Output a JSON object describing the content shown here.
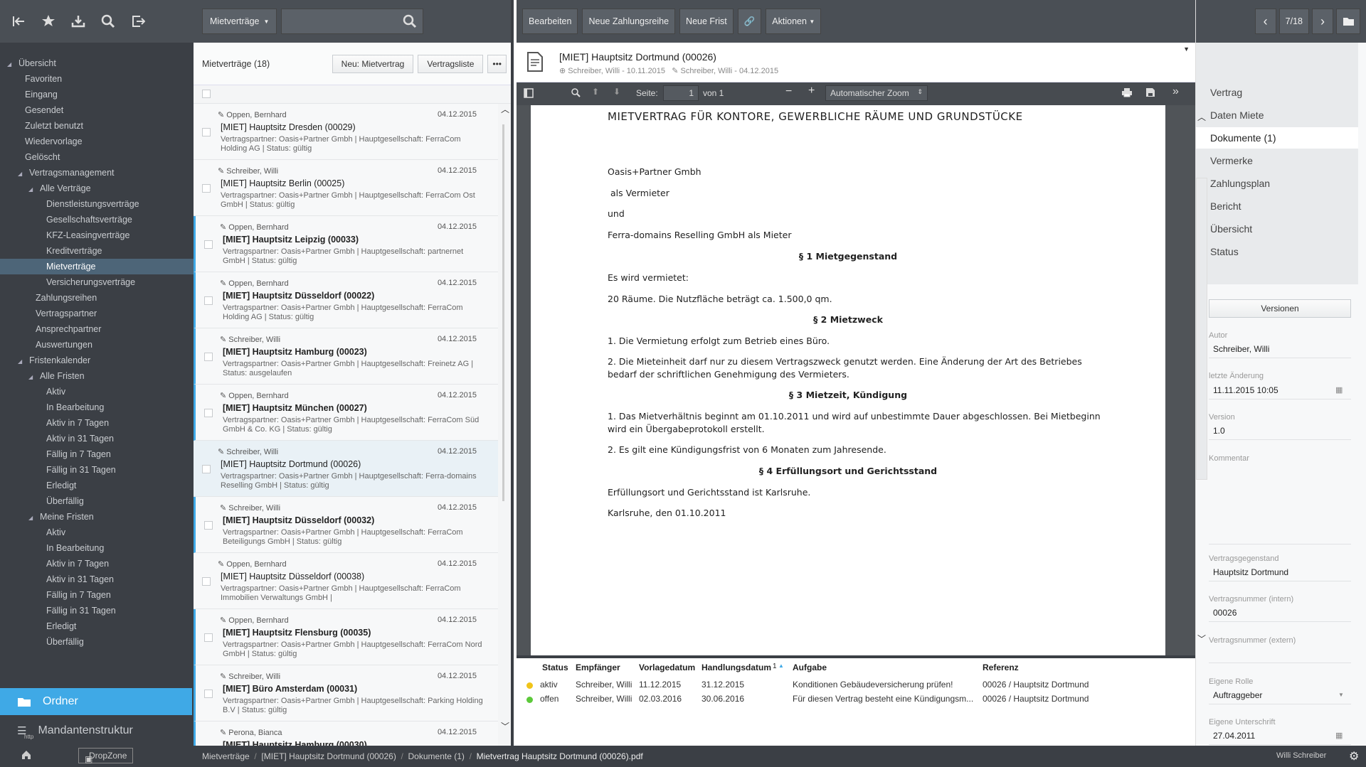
{
  "nav": {
    "tree": [
      {
        "label": "Übersicht",
        "level": 0,
        "expanded": true
      },
      {
        "label": "Favoriten",
        "level": 1
      },
      {
        "label": "Eingang",
        "level": 1
      },
      {
        "label": "Gesendet",
        "level": 1
      },
      {
        "label": "Zuletzt benutzt",
        "level": 1
      },
      {
        "label": "Wiedervorlage",
        "level": 1
      },
      {
        "label": "Gelöscht",
        "level": 1
      },
      {
        "label": "Vertragsmanagement",
        "level": 1,
        "expanded": true
      },
      {
        "label": "Alle Verträge",
        "level": 2,
        "expanded": true
      },
      {
        "label": "Dienstleistungsverträge",
        "level": 3
      },
      {
        "label": "Gesellschaftsverträge",
        "level": 3
      },
      {
        "label": "KFZ-Leasingverträge",
        "level": 3
      },
      {
        "label": "Kreditverträge",
        "level": 3
      },
      {
        "label": "Mietverträge",
        "level": 3,
        "active": true
      },
      {
        "label": "Versicherungsverträge",
        "level": 3
      },
      {
        "label": "Zahlungsreihen",
        "level": 2
      },
      {
        "label": "Vertragspartner",
        "level": 2
      },
      {
        "label": "Ansprechpartner",
        "level": 2
      },
      {
        "label": "Auswertungen",
        "level": 2
      },
      {
        "label": "Fristenkalender",
        "level": 1,
        "expanded": true
      },
      {
        "label": "Alle Fristen",
        "level": 2,
        "expanded": true
      },
      {
        "label": "Aktiv",
        "level": 3
      },
      {
        "label": "In Bearbeitung",
        "level": 3
      },
      {
        "label": "Aktiv in 7 Tagen",
        "level": 3
      },
      {
        "label": "Aktiv in 31 Tagen",
        "level": 3
      },
      {
        "label": "Fällig in 7 Tagen",
        "level": 3
      },
      {
        "label": "Fällig in 31 Tagen",
        "level": 3
      },
      {
        "label": "Erledigt",
        "level": 3
      },
      {
        "label": "Überfällig",
        "level": 3
      },
      {
        "label": "Meine Fristen",
        "level": 2,
        "expanded": true
      },
      {
        "label": "Aktiv",
        "level": 3
      },
      {
        "label": "In Bearbeitung",
        "level": 3
      },
      {
        "label": "Aktiv in 7 Tagen",
        "level": 3
      },
      {
        "label": "Aktiv in 31 Tagen",
        "level": 3
      },
      {
        "label": "Fällig in 7 Tagen",
        "level": 3
      },
      {
        "label": "Fällig in 31 Tagen",
        "level": 3
      },
      {
        "label": "Erledigt",
        "level": 3
      },
      {
        "label": "Überfällig",
        "level": 3
      }
    ],
    "ordner_label": "Ordner",
    "mandant_label": "Mandantenstruktur",
    "http_label": "http"
  },
  "list": {
    "dropdown_label": "Mietverträge",
    "search_placeholder": "",
    "title": "Mietverträge (18)",
    "new_button": "Neu: Mietvertrag",
    "list_button": "Vertragsliste",
    "more_button": "•••",
    "rows": [
      {
        "author": "Oppen, Bernhard",
        "date": "04.12.2015",
        "title": "[MIET] Hauptsitz Dresden (00029)",
        "sub": "Vertragspartner: Oasis+Partner Gmbh  |  Hauptgesellschaft: FerraCom Holding AG  |  Status: gültig",
        "bold": false,
        "hl": false,
        "sel": false
      },
      {
        "author": "Schreiber, Willi",
        "date": "04.12.2015",
        "title": "[MIET] Hauptsitz Berlin (00025)",
        "sub": "Vertragspartner: Oasis+Partner Gmbh  |  Hauptgesellschaft: FerraCom Ost GmbH  |  Status: gültig",
        "bold": false,
        "hl": false,
        "sel": false
      },
      {
        "author": "Oppen, Bernhard",
        "date": "04.12.2015",
        "title": "[MIET] Hauptsitz Leipzig (00033)",
        "sub": "Vertragspartner: Oasis+Partner Gmbh  |  Hauptgesellschaft: partnernet GmbH  |  Status: gültig",
        "bold": true,
        "hl": true,
        "sel": false
      },
      {
        "author": "Oppen, Bernhard",
        "date": "04.12.2015",
        "title": "[MIET] Hauptsitz Düsseldorf (00022)",
        "sub": "Vertragspartner: Oasis+Partner Gmbh  |  Hauptgesellschaft: FerraCom Holding AG  |  Status: gültig",
        "bold": true,
        "hl": true,
        "sel": false
      },
      {
        "author": "Schreiber, Willi",
        "date": "04.12.2015",
        "title": "[MIET] Hauptsitz Hamburg (00023)",
        "sub": "Vertragspartner: Oasis+Partner Gmbh  |  Hauptgesellschaft: Freinetz AG  |  Status: ausgelaufen",
        "bold": true,
        "hl": true,
        "sel": false
      },
      {
        "author": "Oppen, Bernhard",
        "date": "04.12.2015",
        "title": "[MIET] Hauptsitz München (00027)",
        "sub": "Vertragspartner: Oasis+Partner Gmbh  |  Hauptgesellschaft: FerraCom Süd GmbH & Co. KG  |  Status: gültig",
        "bold": true,
        "hl": true,
        "sel": false
      },
      {
        "author": "Schreiber, Willi",
        "date": "04.12.2015",
        "title": "[MIET] Hauptsitz Dortmund (00026)",
        "sub": "Vertragspartner: Oasis+Partner Gmbh  |  Hauptgesellschaft: Ferra-domains Reselling GmbH  |  Status: gültig",
        "bold": false,
        "hl": false,
        "sel": true
      },
      {
        "author": "Schreiber, Willi",
        "date": "04.12.2015",
        "title": "[MIET] Hauptsitz Düsseldorf (00032)",
        "sub": "Vertragspartner: Oasis+Partner Gmbh  |  Hauptgesellschaft: FerraCom Beteiligungs GmbH  |  Status: gültig",
        "bold": true,
        "hl": true,
        "sel": false
      },
      {
        "author": "Oppen, Bernhard",
        "date": "04.12.2015",
        "title": "[MIET] Hauptsitz Düsseldorf (00038)",
        "sub": "Vertragspartner: Oasis+Partner Gmbh  |  Hauptgesellschaft: FerraCom Immobilien Verwaltungs GmbH  |",
        "bold": false,
        "hl": false,
        "sel": false
      },
      {
        "author": "Oppen, Bernhard",
        "date": "04.12.2015",
        "title": "[MIET] Hauptsitz Flensburg (00035)",
        "sub": "Vertragspartner: Oasis+Partner Gmbh  |  Hauptgesellschaft: FerraCom Nord GmbH  |  Status: gültig",
        "bold": true,
        "hl": true,
        "sel": false
      },
      {
        "author": "Schreiber, Willi",
        "date": "04.12.2015",
        "title": "[MIET] Büro Amsterdam (00031)",
        "sub": "Vertragspartner: Oasis+Partner Gmbh  |  Hauptgesellschaft: Parking Holding B.V  |  Status: gültig",
        "bold": true,
        "hl": true,
        "sel": false
      },
      {
        "author": "Perona, Bianca",
        "date": "04.12.2015",
        "title": "[MIET] Hauptsitz Hamburg (00030)",
        "sub": "",
        "bold": true,
        "hl": true,
        "sel": false
      }
    ]
  },
  "doc": {
    "toolbar": [
      "Bearbeiten",
      "Neue Zahlungsreihe",
      "Neue Frist"
    ],
    "actions_label": "Aktionen",
    "title": "[MIET] Hauptsitz Dortmund (00026)",
    "meta1": "Schreiber, Willi - 10.11.2015",
    "meta2": "Schreiber, Willi - 04.12.2015",
    "pdf": {
      "page_label": "Seite:",
      "page_value": "1",
      "page_of": "von 1",
      "zoom": "Automatischer Zoom"
    },
    "page_lines": {
      "heading": "MIETVERTRAG FÜR KONTORE, GEWERBLICHE RÄUME UND GRUNDSTÜCKE",
      "l1": "Oasis+Partner Gmbh",
      "l2": "als Vermieter",
      "l3": "und",
      "l4": "Ferra-domains Reselling GmbH als Mieter",
      "s1": "§ 1 Mietgegenstand",
      "l5": "Es wird vermietet:",
      "l6": "20 Räume. Die Nutzfläche beträgt ca. 1.500,0 qm.",
      "s2": "§ 2 Mietzweck",
      "l7": "1. Die Vermietung erfolgt zum Betrieb eines Büro.",
      "l8": "2. Die Mieteinheit darf nur zu diesem Vertragszweck genutzt werden. Eine Änderung der Art des Betriebes",
      "l9": "bedarf der schriftlichen Genehmigung des Vermieters.",
      "s3": "§ 3 Mietzeit, Kündigung",
      "l10": "1. Das Mietverhältnis beginnt am 01.10.2011 und wird auf unbestimmte Dauer abgeschlossen. Bei Mietbeginn",
      "l11": "wird ein Übergabeprotokoll erstellt.",
      "l12": "2. Es gilt eine Kündigungsfrist von 6 Monaten zum Jahresende.",
      "s4": "§ 4 Erfüllungsort und Gerichtsstand",
      "l13": "Erfüllungsort und Gerichtsstand ist Karlsruhe.",
      "l14": "Karlsruhe, den 01.10.2011"
    },
    "tasks": {
      "headers": {
        "status": "Status",
        "empf": "Empfänger",
        "vorlage": "Vorlagedatum",
        "handl": "Handlungsdatum",
        "sort": "1",
        "aufgabe": "Aufgabe",
        "ref": "Referenz"
      },
      "rows": [
        {
          "color": "#f0c419",
          "status": "aktiv",
          "empf": "Schreiber, Willi",
          "vorlage": "11.12.2015",
          "handl": "31.12.2015",
          "aufgabe": "Konditionen Gebäudeversicherung prüfen!",
          "ref": "00026 / Hauptsitz Dortmund"
        },
        {
          "color": "#5cc93a",
          "status": "offen",
          "empf": "Schreiber, Willi",
          "vorlage": "02.03.2016",
          "handl": "30.06.2016",
          "aufgabe": "Für diesen Vertrag besteht eine Kündigungsm...",
          "ref": "00026 / Hauptsitz Dortmund"
        }
      ]
    }
  },
  "right": {
    "pager": "7/18",
    "menu": [
      "Vertrag",
      "Daten Miete",
      "Dokumente (1)",
      "Vermerke",
      "Zahlungsplan",
      "Bericht",
      "Übersicht",
      "Status"
    ],
    "versions_button": "Versionen",
    "fields": {
      "autor_label": "Autor",
      "autor": "Schreiber, Willi",
      "aenderung_label": "letzte Änderung",
      "aenderung": "11.11.2015  10:05",
      "version_label": "Version",
      "version": "1.0",
      "kommentar_label": "Kommentar",
      "gegenstand_label": "Vertragsgegenstand",
      "gegenstand": "Hauptsitz Dortmund",
      "nr_intern_label": "Vertragsnummer (intern)",
      "nr_intern": "00026",
      "nr_extern_label": "Vertragsnummer (extern)",
      "rolle_label": "Eigene Rolle",
      "rolle": "Auftraggeber",
      "unterschrift_label": "Eigene Unterschrift",
      "unterschrift": "27.04.2011"
    }
  },
  "status": {
    "dropzone": "DropZone",
    "crumbs": [
      "Mietverträge",
      "[MIET] Hauptsitz Dortmund (00026)",
      "Dokumente (1)",
      "Mietvertrag Hauptsitz Dortmund (00026).pdf"
    ],
    "user": "Willi Schreiber"
  }
}
